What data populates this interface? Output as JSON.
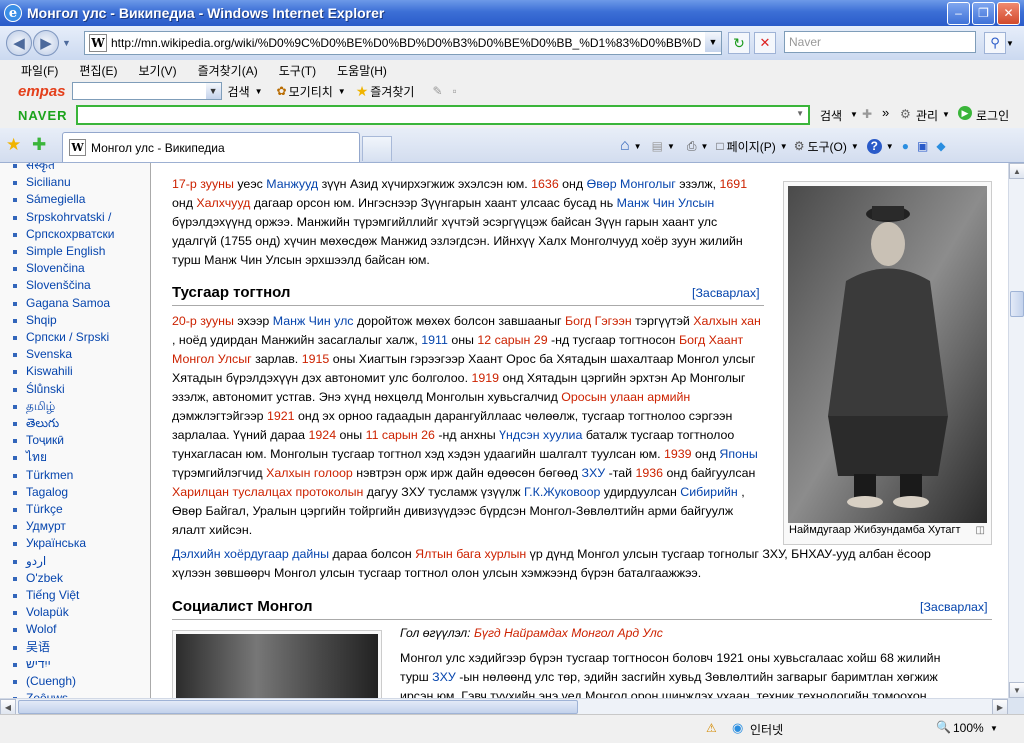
{
  "window": {
    "title": "Монгол улс - Википедиа - Windows Internet Explorer"
  },
  "address_bar": {
    "url": "http://mn.wikipedia.org/wiki/%D0%9C%D0%BE%D0%BD%D0%B3%D0%BE%D0%BB_%D1%83%D0%BB%D1%",
    "search_placeholder": "Naver"
  },
  "menu": [
    "파일(F)",
    "편집(E)",
    "보기(V)",
    "즐겨찾기(A)",
    "도구(T)",
    "도움말(H)"
  ],
  "empas_toolbar": {
    "logo": "empas",
    "search_label": "검색",
    "collect_label": "모기티치",
    "favorites_label": "즐겨찾기"
  },
  "naver_toolbar": {
    "logo": "NAVER",
    "search_label": "검색",
    "manage_label": "관리",
    "login_label": "로그인"
  },
  "tabs": {
    "active_label": "Монгол улс - Википедиа"
  },
  "command_bar": {
    "page_label": "페이지(P)",
    "tools_label": "도구(O)"
  },
  "sidebar": {
    "languages": [
      "संस्कृत",
      "Sicilianu",
      "Sámegiella",
      "Srpskohrvatski /",
      "Српскохрватски",
      "Simple English",
      "Slovenčina",
      "Slovenščina",
      "Gagana Samoa",
      "Shqip",
      "Српски / Srpski",
      "Svenska",
      "Kiswahili",
      "Ślůnski",
      "தமிழ்",
      "తెలుగు",
      "Тоҷикӣ",
      "ไทย",
      "Türkmen",
      "Tagalog",
      "Türkçe",
      "Удмурт",
      "Українська",
      "اردو",
      "O'zbek",
      "Tiếng Việt",
      "Volapük",
      "Wolof",
      "吴语",
      "ייִדיש",
      "(Cuengh)",
      "Zeêuws"
    ]
  },
  "article": {
    "section1_heading": "Тусгаар тогтнол",
    "section2_heading": "Социалист Монгол",
    "edit_label": "[Засварлах]",
    "image_caption": "Наймдугаар Жибзундамба Хутагт",
    "main_article_prefix": "Гол өгүүлэл:",
    "main_article_link": "Бүгд Найрамдах Монгол Ард Улс",
    "para0": [
      [
        "r",
        "17-р зууны"
      ],
      [
        "",
        " уеэс "
      ],
      [
        "b",
        "Манжууд"
      ],
      [
        "",
        " зүүн Азид хүчирхэгжиж эхэлсэн юм. "
      ],
      [
        "r",
        "1636"
      ],
      [
        "",
        " онд "
      ],
      [
        "b",
        "Өвөр Монголыг"
      ],
      [
        "",
        " эзэлж, "
      ],
      [
        "r",
        "1691"
      ],
      [
        "",
        " онд "
      ],
      [
        "r",
        "Халхчууд"
      ],
      [
        "",
        " дагаар орсон юм. Ингэснээр Зүүнгарын хаант улсаас бусад нь "
      ],
      [
        "b",
        "Манж Чин Улсын"
      ],
      [
        "",
        " бүрэлдэхүүнд оржээ. Манжийн түрэмгийллийг хүчтэй эсэргүүцэж байсан Зүүн гарын хаант улс удалгүй (1755 онд) хүчин мөхөсдөж Манжид эзлэгдсэн. Ийнхүү Халх Монголчууд хоёр зуун жилийн турш Манж Чин Улсын эрхшээлд байсан юм."
      ]
    ],
    "para1": [
      [
        "r",
        "20-р зууны"
      ],
      [
        "",
        " эхээр "
      ],
      [
        "b",
        "Манж Чин улс"
      ],
      [
        "",
        " доройтож мөхөх болсон завшааныг "
      ],
      [
        "r",
        "Богд Гэгээн"
      ],
      [
        "",
        " тэргүүтэй "
      ],
      [
        "r",
        "Халхын хан"
      ],
      [
        "",
        " , ноёд удирдан Манжийн засаглалыг халж, "
      ],
      [
        "b",
        "1911"
      ],
      [
        "",
        " оны "
      ],
      [
        "r",
        "12 сарын 29"
      ],
      [
        "",
        " -нд тусгаар тогтносон "
      ],
      [
        "r",
        "Богд Хаант Монгол Улсыг"
      ],
      [
        "",
        " зарлав. "
      ],
      [
        "r",
        "1915"
      ],
      [
        "",
        " оны Хиагтын гэрээгээр Хаант Орос ба Хятадын шахалтаар Монгол улсыг Хятадын бүрэлдэхүүн дэх автономит улс болголоо. "
      ],
      [
        "r",
        "1919"
      ],
      [
        "",
        " онд Хятадын цэргийн эрхтэн Ар Монголыг эзэлж, автономит устгав. Энэ хүнд нөхцөлд Монголын хувьсгалчид "
      ],
      [
        "r",
        "Оросын улаан армийн"
      ],
      [
        "",
        " дэмжлэгтэйгээр "
      ],
      [
        "r",
        "1921"
      ],
      [
        "",
        " онд эх орноо гадаадын дарангуйллаас чөлөөлж, тусгаар тогтнолоо сэргээн зарлалаа. Үүний дараа "
      ],
      [
        "r",
        "1924"
      ],
      [
        "",
        " оны "
      ],
      [
        "r",
        "11 сарын 26"
      ],
      [
        "",
        " -нд анхны "
      ],
      [
        "b",
        "Үндсэн хуулиа"
      ],
      [
        "",
        " баталж тусгаар тогтнолоо тунхагласан юм. Монголын тусгаар тогтнол хэд хэдэн удаагийн шалгалт туулсан юм. "
      ],
      [
        "r",
        "1939"
      ],
      [
        "",
        " онд "
      ],
      [
        "b",
        "Японы"
      ],
      [
        "",
        " түрэмгийлэгчид "
      ],
      [
        "r",
        "Халхын голоор"
      ],
      [
        "",
        " нэвтрэн орж ирж дайн өдөөсөн бөгөөд "
      ],
      [
        "b",
        "ЗХУ"
      ],
      [
        "",
        " -тай "
      ],
      [
        "r",
        "1936"
      ],
      [
        "",
        " онд байгуулсан "
      ],
      [
        "r",
        "Харилцан туслалцах протоколын"
      ],
      [
        "",
        " дагуу ЗХУ тусламж үзүүлж "
      ],
      [
        "b",
        "Г.К.Жуковоор"
      ],
      [
        "",
        " удирдуулсан "
      ],
      [
        "b",
        "Сибирийн"
      ],
      [
        "",
        " , Өвөр Байгал, Уралын цэргийн тойргийн дивизүүдээс бүрдсэн Монгол-Зөвлөлтийн арми байгуулж ялалт хийсэн."
      ]
    ],
    "para2": [
      [
        "b",
        "Дэлхийн хоёрдугаар дайны"
      ],
      [
        "",
        " дараа болсон "
      ],
      [
        "r",
        "Ялтын бага хурлын"
      ],
      [
        "",
        " үр дүнд Монгол улсын тусгаар тогнолыг ЗХУ, БНХАУ-ууд албан ёсоор хүлээн зөвшөөрч Монгол улсын тусгаар тогтнол олон улсын хэмжээнд бүрэн баталгаажжээ."
      ]
    ],
    "para3": [
      [
        "",
        " Монгол улс хэдийгээр бүрэн тусгаар тогтносон боловч 1921 оны хувьсгалаас хойш 68 жилийн турш "
      ],
      [
        "b",
        "ЗХУ"
      ],
      [
        "",
        " -ын нөлөөнд улс төр, эдийн засгийн хувьд Зөвлөлтийн загварыг баримтлан хөгжиж ирсэн юм. Гэвч түүхийн энэ үед Монгол орон шинжлэх ухаан, техник технологийн томоохон"
      ]
    ]
  },
  "status_bar": {
    "zone": "인터넷",
    "zoom": "100%"
  }
}
